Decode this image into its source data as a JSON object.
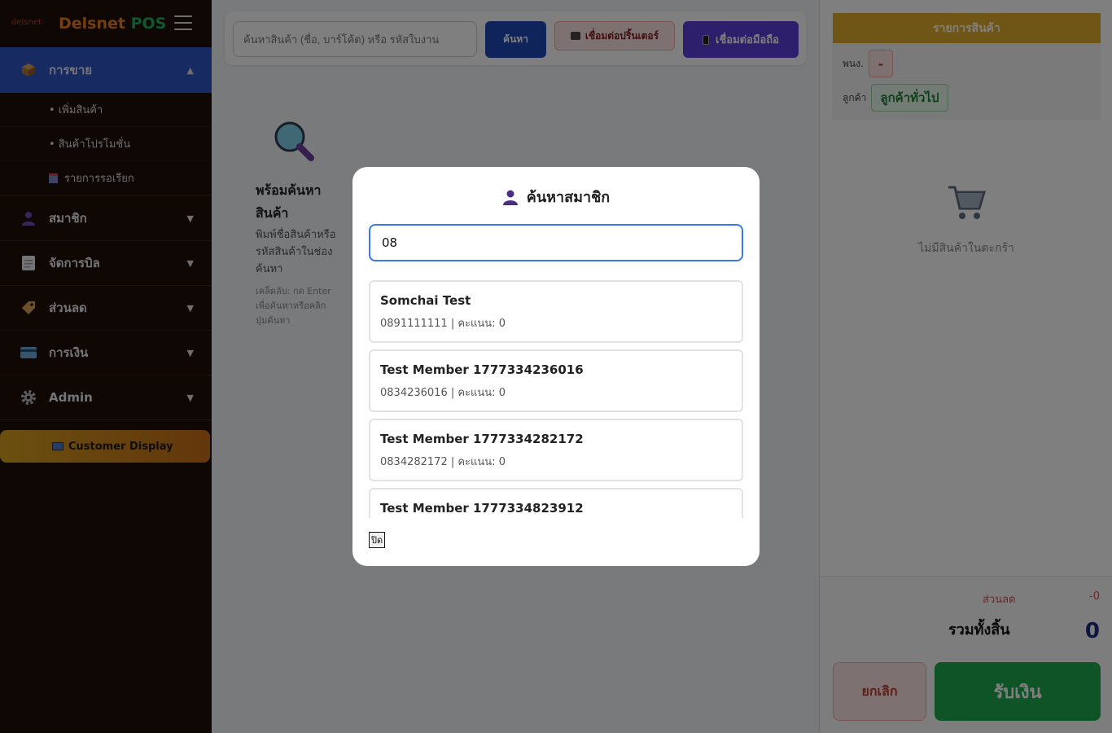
{
  "sidebar": {
    "brand_logo": "delsnet",
    "brand_name": "Delsnet",
    "brand_suffix": "POS",
    "sales": {
      "label": "การขาย",
      "items": [
        {
          "label": "• เพิ่มสินค้า"
        },
        {
          "label": "• สินค้าโปรโมชั่น"
        },
        {
          "label": "รายการรอเรียก"
        }
      ]
    },
    "groups": [
      {
        "label": "สมาชิก"
      },
      {
        "label": "จัดการบิล"
      },
      {
        "label": "ส่วนลด"
      },
      {
        "label": "การเงิน"
      },
      {
        "label": "Admin"
      }
    ],
    "customer_display": "Customer Display"
  },
  "toolbar": {
    "search_placeholder": "ค้นหาสินค้า (ชื่อ, บาร์โค้ด) หรือ รหัสใบงาน",
    "search_label": "ค้นหา",
    "printer_label": "เชื่อมต่อปริ้นเตอร์",
    "mobile_label": "เชื่อมต่อมือถือ"
  },
  "empty_state": {
    "title": "พร้อมค้นหาสินค้า",
    "desc": "พิมพ์ชื่อสินค้าหรือรหัสสินค้าในช่องค้นหา",
    "hint": "เคล็ดลับ: กด Enter เพื่อค้นหาหรือคลิกปุ่มค้นหา"
  },
  "cart": {
    "header": "รายการสินค้า",
    "staff_label": "พนง.",
    "staff_value": "-",
    "customer_label": "ลูกค้า",
    "customer_value": "ลูกค้าทั่วไป",
    "empty_text": "ไม่มีสินค้าในตะกร้า",
    "discount_label": "ส่วนลด",
    "discount_value": "-0",
    "total_label": "รวมทั้งสิ้น",
    "total_value": "0",
    "cancel_label": "ยกเลิก",
    "pay_label": "รับเงิน"
  },
  "modal": {
    "title": "ค้นหาสมาชิก",
    "search_value": "08",
    "results": [
      {
        "name": "Somchai Test",
        "info": "0891111111 | คะแนน: 0"
      },
      {
        "name": "Test Member 1777334236016",
        "info": "0834236016 | คะแนน: 0"
      },
      {
        "name": "Test Member 1777334282172",
        "info": "0834282172 | คะแนน: 0"
      },
      {
        "name": "Test Member 1777334823912",
        "info": ""
      }
    ],
    "close_label": "ปิด"
  }
}
